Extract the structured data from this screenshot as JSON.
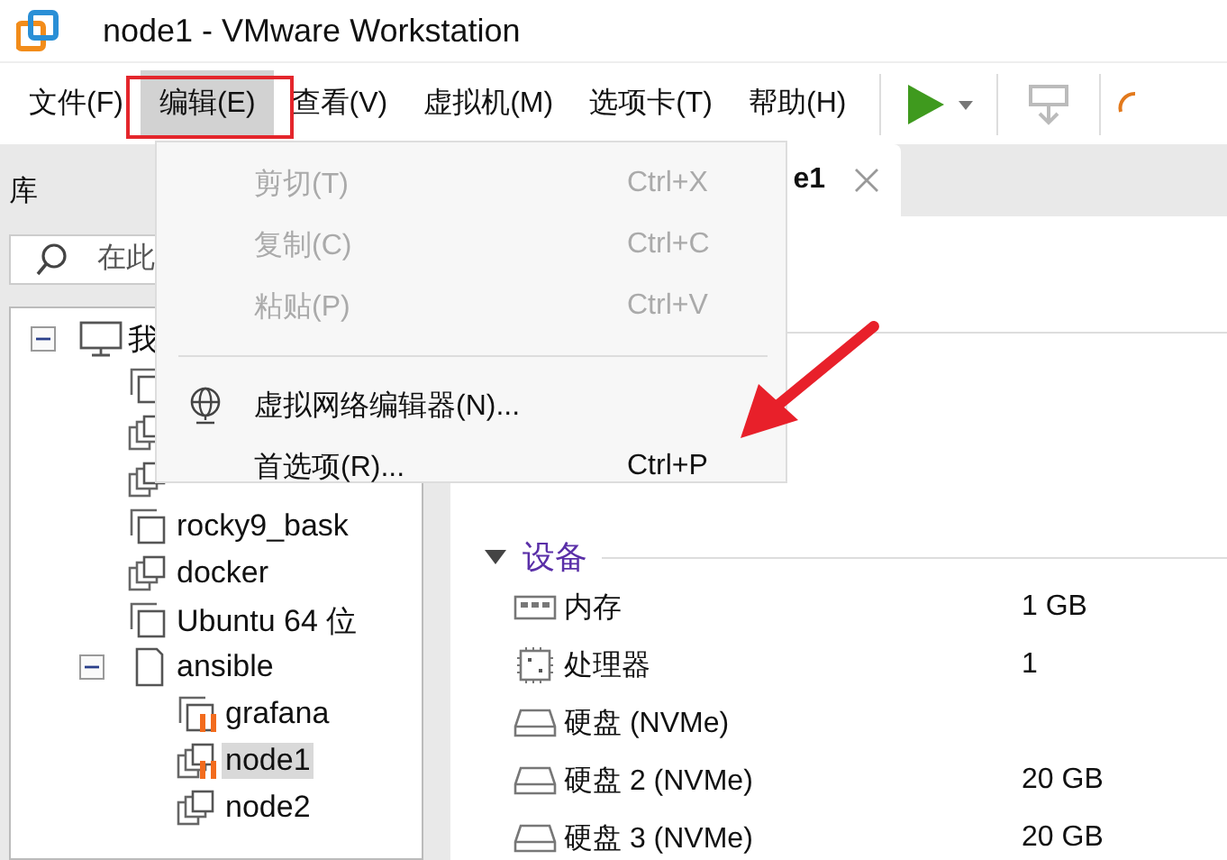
{
  "window": {
    "title": "node1 - VMware Workstation"
  },
  "menu_bar": [
    {
      "label": "文件(F)",
      "selected": false
    },
    {
      "label": "编辑(E)",
      "selected": true
    },
    {
      "label": "查看(V)",
      "selected": false
    },
    {
      "label": "虚拟机(M)",
      "selected": false
    },
    {
      "label": "选项卡(T)",
      "selected": false
    },
    {
      "label": "帮助(H)",
      "selected": false
    }
  ],
  "edit_menu": [
    {
      "kind": "command",
      "label": "剪切(T)",
      "shortcut": "Ctrl+X",
      "disabled": true
    },
    {
      "kind": "command",
      "label": "复制(C)",
      "shortcut": "Ctrl+C",
      "disabled": true
    },
    {
      "kind": "command",
      "label": "粘贴(P)",
      "shortcut": "Ctrl+V",
      "disabled": true
    },
    {
      "kind": "separator"
    },
    {
      "kind": "network",
      "label": "虚拟网络编辑器(N)...",
      "disabled": false
    },
    {
      "kind": "command",
      "label": "首选项(R)...",
      "shortcut": "Ctrl+P",
      "disabled": false
    }
  ],
  "library": {
    "title": "库",
    "search": {
      "placeholder": "在此"
    },
    "tree": [
      {
        "kind": "computer",
        "label": "我",
        "expanded": true,
        "selected": false,
        "children": [
          {
            "kind": "vm",
            "running": false
          },
          {
            "kind": "linked",
            "running": false
          },
          {
            "kind": "linked",
            "running": false
          },
          {
            "kind": "vm",
            "label": "rocky9_bask",
            "running": false,
            "selected": false
          },
          {
            "kind": "linked",
            "label": "docker",
            "running": false,
            "selected": false
          },
          {
            "kind": "vm",
            "label": "Ubuntu 64 位",
            "running": false,
            "selected": false
          },
          {
            "kind": "folder",
            "label": "ansible",
            "expanded": true,
            "selected": false,
            "children": [
              {
                "kind": "vm",
                "label": "grafana",
                "running": true,
                "selected": false
              },
              {
                "kind": "linked",
                "label": "node1",
                "running": true,
                "selected": true
              },
              {
                "kind": "linked",
                "label": "node2",
                "running": false,
                "selected": false
              }
            ]
          }
        ]
      }
    ]
  },
  "tab": {
    "label": "e1"
  },
  "devices": {
    "title": "设备",
    "expanded": true,
    "rows": [
      {
        "kind": "memory",
        "name": "内存",
        "value": "1 GB"
      },
      {
        "kind": "cpu",
        "name": "处理器",
        "value": "1"
      },
      {
        "kind": "disk",
        "name": "硬盘 (NVMe)"
      },
      {
        "kind": "disk",
        "name": "硬盘 2 (NVMe)",
        "value": "20 GB"
      },
      {
        "kind": "disk",
        "name": "硬盘 3 (NVMe)",
        "value": "20 GB"
      }
    ]
  }
}
